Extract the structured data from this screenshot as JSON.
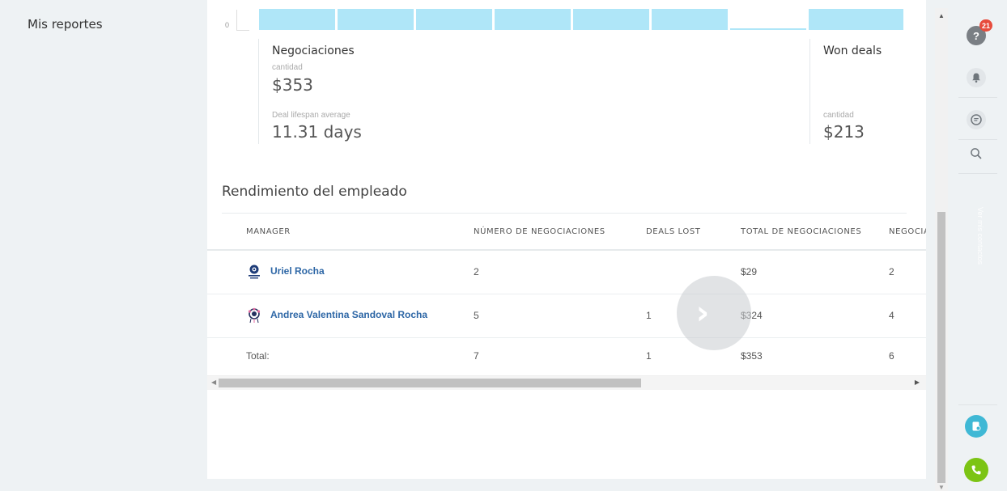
{
  "sidebar": {
    "items": [
      {
        "label": "Mis reportes"
      }
    ]
  },
  "chart_data": {
    "type": "bar",
    "categories": [],
    "values": [],
    "visible_tick_label": "0",
    "bar_color": "#afe6f8"
  },
  "stats": {
    "deals": {
      "title": "Negociaciones",
      "amount_caption": "cantidad",
      "amount_value": "$353",
      "lifespan_caption": "Deal lifespan average",
      "lifespan_value": "11.31 days"
    },
    "won": {
      "title": "Won deals",
      "amount_caption": "cantidad",
      "amount_value": "$213"
    }
  },
  "employee": {
    "title": "Rendimiento del empleado",
    "columns": [
      "MANAGER",
      "NÚMERO DE NEGOCIACIONES",
      "DEALS LOST",
      "TOTAL DE NEGOCIACIONES",
      "NEGOCIACIONES GANADAS"
    ],
    "rows": [
      {
        "manager": "Uriel Rocha",
        "deals": "2",
        "lost": "",
        "total": "$29",
        "won": "2"
      },
      {
        "manager": "Andrea Valentina Sandoval Rocha",
        "deals": "5",
        "lost": "1",
        "total": "$324",
        "won": "4"
      }
    ],
    "total": {
      "label": "Total:",
      "deals": "7",
      "lost": "1",
      "total": "$353",
      "won": "6"
    }
  },
  "toolbar": {
    "help_badge": "21",
    "vertical_label": "Ver mis contactos"
  },
  "colors": {
    "accent_blue": "#2e67a6",
    "badge_red": "#e74c3c",
    "teal": "#3fb8d5",
    "green": "#7cc414"
  }
}
